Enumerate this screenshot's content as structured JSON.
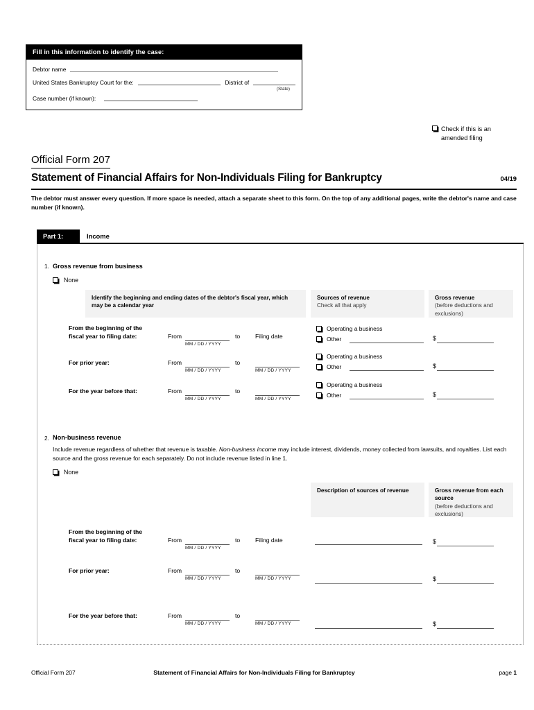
{
  "case_box": {
    "header": "Fill in this information to identify the case:",
    "debtor_label": "Debtor name",
    "court_label": "United States Bankruptcy Court for the:",
    "district_label": "District of",
    "state_note": "(State)",
    "case_number_label": "Case number (if known):"
  },
  "amended": {
    "line1": "Check if this is an",
    "line2": "amended filing",
    "full": "Check if this is an amended filing"
  },
  "title": {
    "form_number": "Official Form 207",
    "form_title": "Statement of Financial Affairs for Non-Individuals Filing for Bankruptcy",
    "revision": "04/19",
    "instructions_line1": "The debtor must answer every question. If more space is needed, attach a separate sheet to this form. On the top of any additional pages,",
    "instructions_line2": "write the debtor's name and case number (if known)."
  },
  "part1": {
    "tag": "Part 1:",
    "title": "Income"
  },
  "q1": {
    "number": "1.",
    "heading": "Gross revenue from business",
    "none_label": "None",
    "table_headers": {
      "dates": "Identify the beginning and ending dates of the debtor's fiscal year, which may be a calendar year",
      "sources_title": "Sources of revenue",
      "sources_sub": "Check all that apply",
      "gross_title": "Gross revenue",
      "gross_sub": "(before deductions and exclusions)"
    },
    "rows": [
      {
        "label_line1": "From the beginning of the",
        "label_line2": "fiscal year to filing date:",
        "from_word": "From",
        "to_word": "to",
        "from_hint": "MM / DD / YYYY",
        "to_value": "Filing date",
        "to_hint": "",
        "opt1": "Operating a business",
        "opt2": "Other",
        "currency": "$"
      },
      {
        "label_line1": "For prior year:",
        "label_line2": "",
        "from_word": "From",
        "to_word": "to",
        "from_hint": "MM / DD / YYYY",
        "to_value": "",
        "to_hint": "MM / DD / YYYY",
        "opt1": "Operating a business",
        "opt2": "Other",
        "currency": "$"
      },
      {
        "label_line1": "For the year before that:",
        "label_line2": "",
        "from_word": "From",
        "to_word": "to",
        "from_hint": "MM / DD / YYYY",
        "to_value": "",
        "to_hint": "MM / DD / YYYY",
        "opt1": "Operating a business",
        "opt2": "Other",
        "currency": "$"
      }
    ]
  },
  "q2": {
    "number": "2.",
    "heading": "Non-business revenue",
    "desc_part1": "Include revenue regardless of whether that revenue is taxable. ",
    "desc_italic": "Non-business income",
    "desc_part2": " may include interest, dividends, money collected",
    "desc_line2": "from lawsuits, and royalties. List each source and the gross revenue for each separately. Do not include revenue listed in line 1.",
    "none_label": "None",
    "table_headers": {
      "description_title": "Description of sources of revenue",
      "gross_title": "Gross revenue from each source",
      "gross_sub": "(before deductions and exclusions)"
    },
    "rows": [
      {
        "label_line1": "From the beginning of the",
        "label_line2": "fiscal year to filing date:",
        "from_word": "From",
        "to_word": "to",
        "from_hint": "MM / DD / YYYY",
        "to_value": "Filing date",
        "to_hint": "",
        "currency": "$"
      },
      {
        "label_line1": "For prior year:",
        "label_line2": "",
        "from_word": "From",
        "to_word": "to",
        "from_hint": "MM / DD / YYYY",
        "to_value": "",
        "to_hint": "MM / DD / YYYY",
        "currency": "$"
      },
      {
        "label_line1": "For the year before that:",
        "label_line2": "",
        "from_word": "From",
        "to_word": "to",
        "from_hint": "MM / DD / YYYY",
        "to_value": "",
        "to_hint": "MM / DD / YYYY",
        "currency": "$"
      }
    ]
  },
  "footer": {
    "left": "Official Form 207",
    "center": "Statement of Financial Affairs for Non-Individuals Filing for Bankruptcy",
    "page_word": "page",
    "page_number": "1"
  },
  "colors": {
    "header_bar": "#000000",
    "table_header_bg": "#f2f2f2",
    "rule": "#555555"
  }
}
